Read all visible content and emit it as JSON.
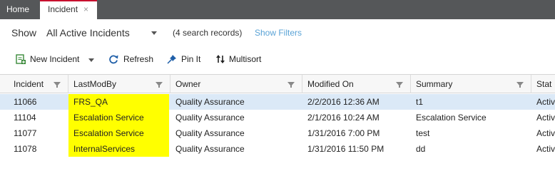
{
  "tabs": {
    "home_label": "Home",
    "incident_label": "Incident",
    "close_glyph": "×"
  },
  "show": {
    "label": "Show",
    "value": "All Active Incidents",
    "records": "(4 search records)",
    "show_filters": "Show Filters"
  },
  "toolbar": {
    "new_incident": "New Incident",
    "refresh": "Refresh",
    "pin_it": "Pin It",
    "multisort": "Multisort"
  },
  "grid": {
    "columns": [
      "Incident",
      "LastModBy",
      "Owner",
      "Modified On",
      "Summary",
      "Stat"
    ],
    "rows": [
      {
        "incident": "11066",
        "lastmodby": "FRS_QA",
        "owner": "Quality Assurance",
        "modified": "2/2/2016 12:36 AM",
        "summary": "t1",
        "status": "Activ",
        "selected": true
      },
      {
        "incident": "11104",
        "lastmodby": "Escalation Service",
        "owner": "Quality Assurance",
        "modified": "2/1/2016 10:24 AM",
        "summary": "Escalation Service",
        "status": "Activ",
        "selected": false
      },
      {
        "incident": "11077",
        "lastmodby": "Escalation Service",
        "owner": "Quality Assurance",
        "modified": "1/31/2016 7:00 PM",
        "summary": "test",
        "status": "Activ",
        "selected": false
      },
      {
        "incident": "11078",
        "lastmodby": "InternalServices",
        "owner": "Quality Assurance",
        "modified": "1/31/2016 11:50 PM",
        "summary": "dd",
        "status": "Activ",
        "selected": false
      }
    ]
  },
  "colors": {
    "tabbar": "#555759",
    "active_tab_border": "#c8102e",
    "link": "#5aa3d6",
    "selected_row": "#dbe9f7",
    "highlight": "#ffff00"
  },
  "icons": {
    "new_incident": "new-document-icon",
    "refresh": "refresh-icon",
    "pin_it": "pin-icon",
    "multisort": "sort-icon"
  }
}
